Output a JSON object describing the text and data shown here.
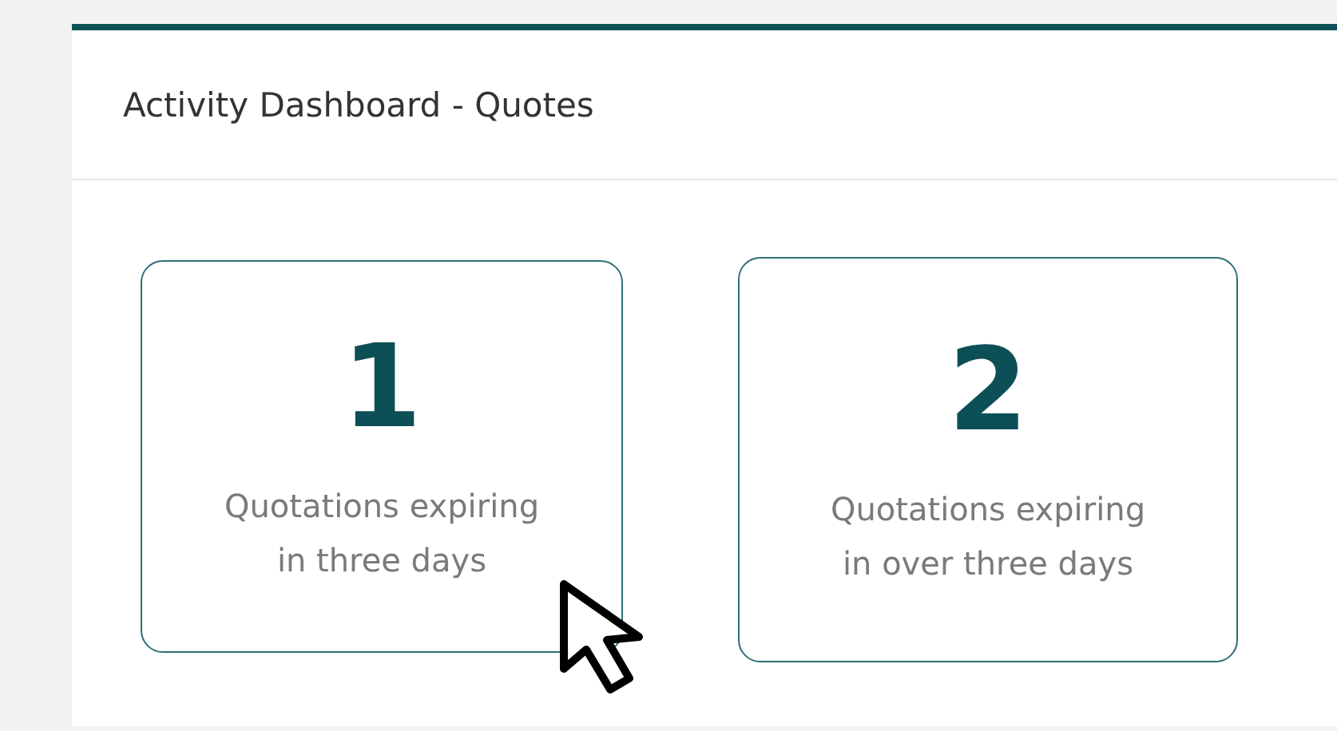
{
  "panel": {
    "title": "Activity Dashboard - Quotes"
  },
  "cards": [
    {
      "value": "1",
      "lines": [
        "Quotations expiring",
        "in three days"
      ]
    },
    {
      "value": "2",
      "lines": [
        "Quotations expiring",
        "in over three days"
      ]
    }
  ]
}
